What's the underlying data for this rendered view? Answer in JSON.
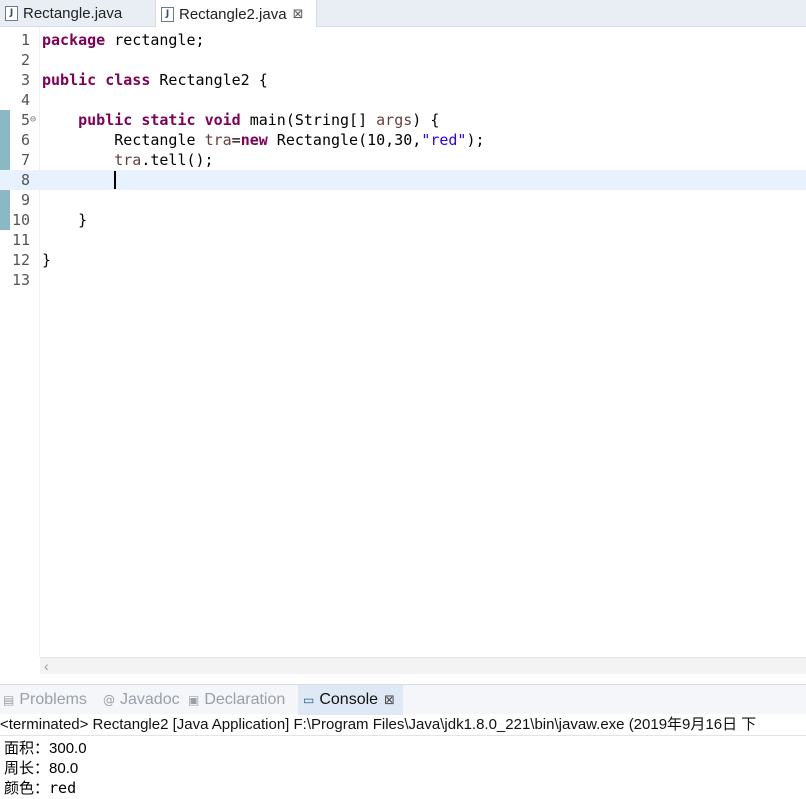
{
  "editor_tabs": [
    {
      "icon": "java-file-icon",
      "label": "Rectangle.java",
      "active": false
    },
    {
      "icon": "java-file-icon",
      "label": "Rectangle2.java",
      "active": true
    }
  ],
  "close_glyph": "⊠",
  "line_numbers": [
    "1",
    "2",
    "3",
    "4",
    "5",
    "6",
    "7",
    "8",
    "9",
    "10",
    "11",
    "12",
    "13"
  ],
  "code": {
    "l1_kw": "package",
    "l1_rest": " rectangle;",
    "l3_kw1": "public",
    "l3_kw2": "class",
    "l3_rest": " Rectangle2 {",
    "l5_indent": "    ",
    "l5_kw1": "public",
    "l5_kw2": "static",
    "l5_kw3": "void",
    "l5_mid": " main(String[] ",
    "l5_var": "args",
    "l5_end": ") {",
    "l6_lead": "        Rectangle ",
    "l6_var": "tra",
    "l6_eq": "=",
    "l6_kw": "new",
    "l6_mid": " Rectangle(10,30,",
    "l6_str": "\"red\"",
    "l6_end": ");",
    "l7_lead": "        ",
    "l7_var": "tra",
    "l7_rest": ".tell();",
    "l10": "    }",
    "l12": "}"
  },
  "panel_tabs": [
    {
      "icon": "problems-icon",
      "label": "Problems"
    },
    {
      "icon": "javadoc-icon",
      "label": "Javadoc"
    },
    {
      "icon": "declaration-icon",
      "label": "Declaration"
    },
    {
      "icon": "console-icon",
      "label": "Console",
      "active": true
    }
  ],
  "console": {
    "header": "<terminated> Rectangle2 [Java Application] F:\\Program Files\\Java\\jdk1.8.0_221\\bin\\javaw.exe (2019年9月16日 下",
    "lines": [
      {
        "label": "面积：",
        "value": "300.0"
      },
      {
        "label": "周长：",
        "value": "80.0"
      },
      {
        "label": "颜色：",
        "value": "red"
      }
    ]
  },
  "colors": {
    "keyword": "#7f0055",
    "variable": "#6a3e3e",
    "string": "#2a00ff",
    "current_line": "#e8f2fe"
  }
}
